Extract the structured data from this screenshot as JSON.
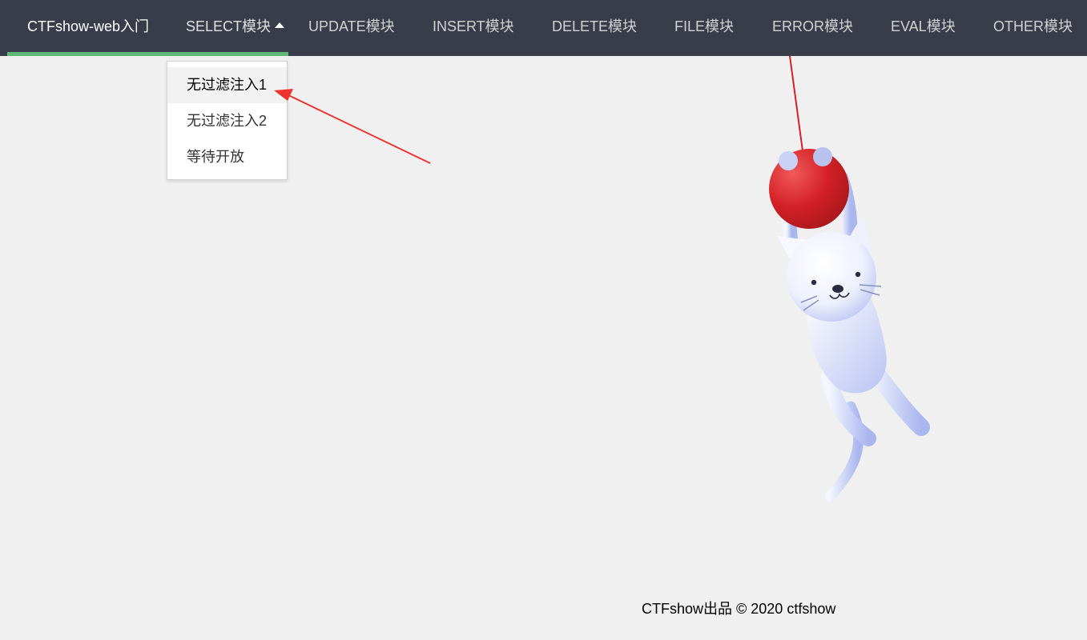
{
  "nav": {
    "brand": "CTFshow-web入门",
    "items": [
      {
        "label": "SELECT模块"
      },
      {
        "label": "UPDATE模块"
      },
      {
        "label": "INSERT模块"
      },
      {
        "label": "DELETE模块"
      },
      {
        "label": "FILE模块"
      },
      {
        "label": "ERROR模块"
      },
      {
        "label": "EVAL模块"
      },
      {
        "label": "OTHER模块"
      }
    ],
    "active_item": "SELECT模块"
  },
  "dropdown": {
    "items": [
      {
        "label": "无过滤注入1",
        "highlighted": true
      },
      {
        "label": "无过滤注入2",
        "highlighted": false
      },
      {
        "label": "等待开放",
        "highlighted": false
      }
    ]
  },
  "footer": {
    "text": "CTFshow出品 © 2020 ctfshow"
  },
  "colors": {
    "nav_bg": "#393d49",
    "nav_accent": "#5fb878",
    "page_bg": "#f0f0f0",
    "annotation_arrow": "#ee3333",
    "ball": "#d42026"
  },
  "icons": {
    "caret": "caret-up-icon",
    "illustration": "hanging-cat-with-ball"
  }
}
